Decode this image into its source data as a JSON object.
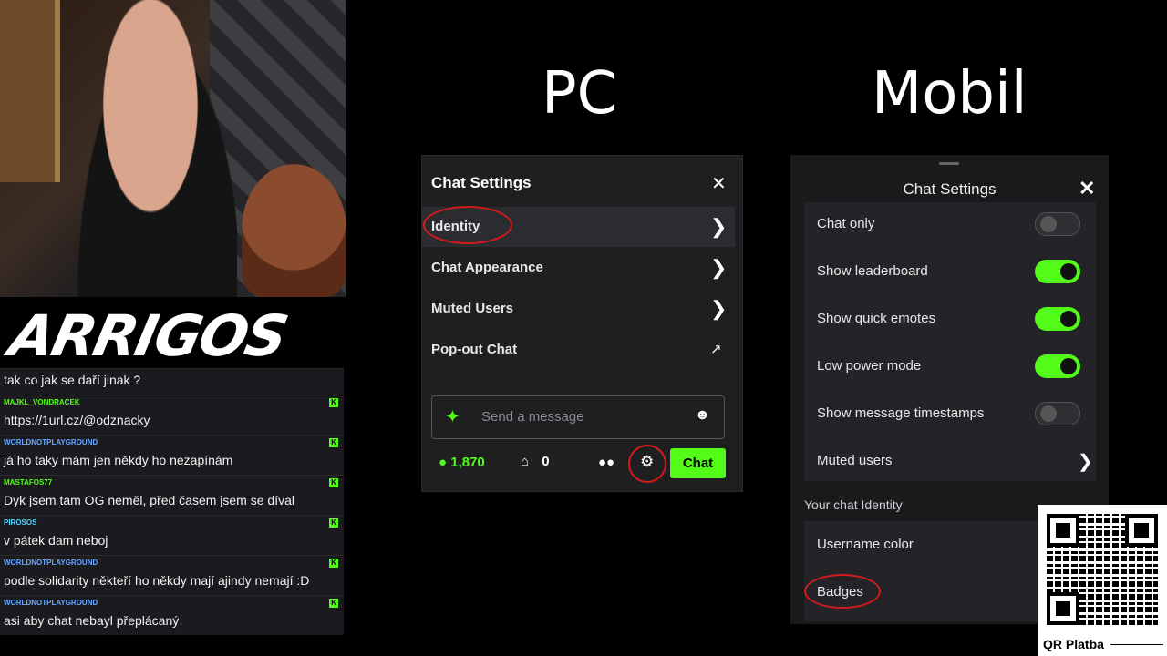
{
  "stream": {
    "logo_text": "ARRIGOS",
    "first_message": "tak co jak se daří jinak ?",
    "messages": [
      {
        "user": "MAJKL_VONDRACEK",
        "color": "#53fc18",
        "text": "https://1url.cz/@odznacky"
      },
      {
        "user": "WORLDNOTPLAYGROUND",
        "color": "#6aa7ff",
        "text": "já ho taky mám jen někdy ho nezapínám"
      },
      {
        "user": "MASTAFOS77",
        "color": "#53fc18",
        "text": "Dyk jsem tam OG neměl, před časem jsem se díval"
      },
      {
        "user": "PIROSOS",
        "color": "#53d2ff",
        "text": "v pátek dam neboj"
      },
      {
        "user": "WORLDNOTPLAYGROUND",
        "color": "#6aa7ff",
        "text": "podle solidarity někteří ho někdy mají ajindy nemají :D"
      },
      {
        "user": "WORLDNOTPLAYGROUND",
        "color": "#6aa7ff",
        "text": "asi aby chat nebayl přeplácaný"
      }
    ],
    "kick_badge": "K"
  },
  "slide": {
    "pc_heading": "PC",
    "mobile_heading": "Mobil"
  },
  "pc_panel": {
    "title": "Chat Settings",
    "close": "✕",
    "items": [
      {
        "label": "Identity",
        "icon": "chevron-right-icon"
      },
      {
        "label": "Chat Appearance",
        "icon": "chevron-right-icon"
      },
      {
        "label": "Muted Users",
        "icon": "chevron-right-icon"
      },
      {
        "label": "Pop-out Chat",
        "icon": "external-link-icon"
      }
    ],
    "input_placeholder": "Send a message",
    "points": "1,870",
    "store_count": "0",
    "chat_button": "Chat",
    "accent": "#53fc18"
  },
  "mobile_panel": {
    "title": "Chat Settings",
    "close": "✕",
    "settings": [
      {
        "label": "Chat only",
        "on": false
      },
      {
        "label": "Show leaderboard",
        "on": true
      },
      {
        "label": "Show quick emotes",
        "on": true
      },
      {
        "label": "Low power mode",
        "on": true
      },
      {
        "label": "Show message timestamps",
        "on": false
      }
    ],
    "muted_users": "Muted users",
    "identity_section": "Your chat Identity",
    "identity_items": [
      "Username color",
      "Badges"
    ]
  },
  "qr": {
    "label": "QR Platba"
  }
}
